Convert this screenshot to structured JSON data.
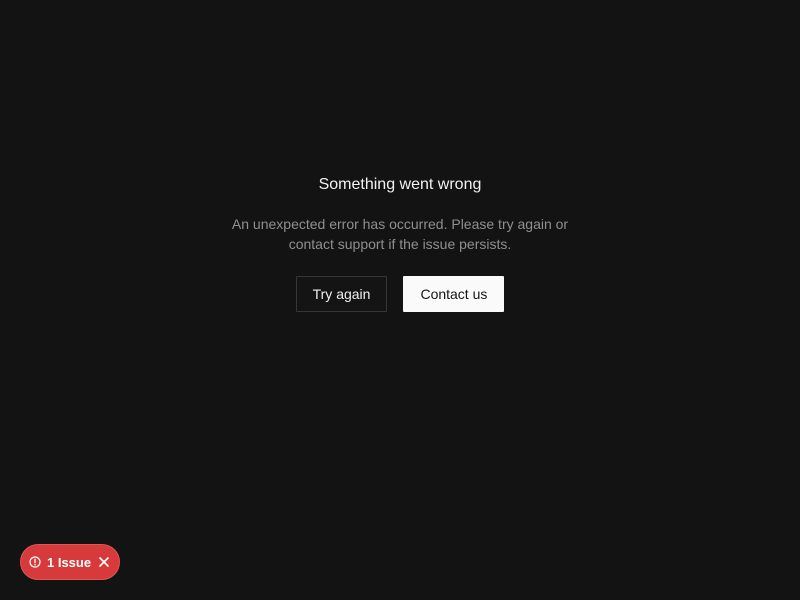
{
  "error": {
    "title": "Something went wrong",
    "message": "An unexpected error has occurred. Please try again or contact support if the issue persists.",
    "actions": {
      "retry_label": "Try again",
      "contact_label": "Contact us"
    }
  },
  "issues_badge": {
    "label": "1 Issue",
    "icon": "alert-circle-icon",
    "dismiss_icon": "close-icon",
    "color": "#d63a3a"
  },
  "theme": {
    "background": "#131313",
    "primary_button": "#fafafa"
  }
}
